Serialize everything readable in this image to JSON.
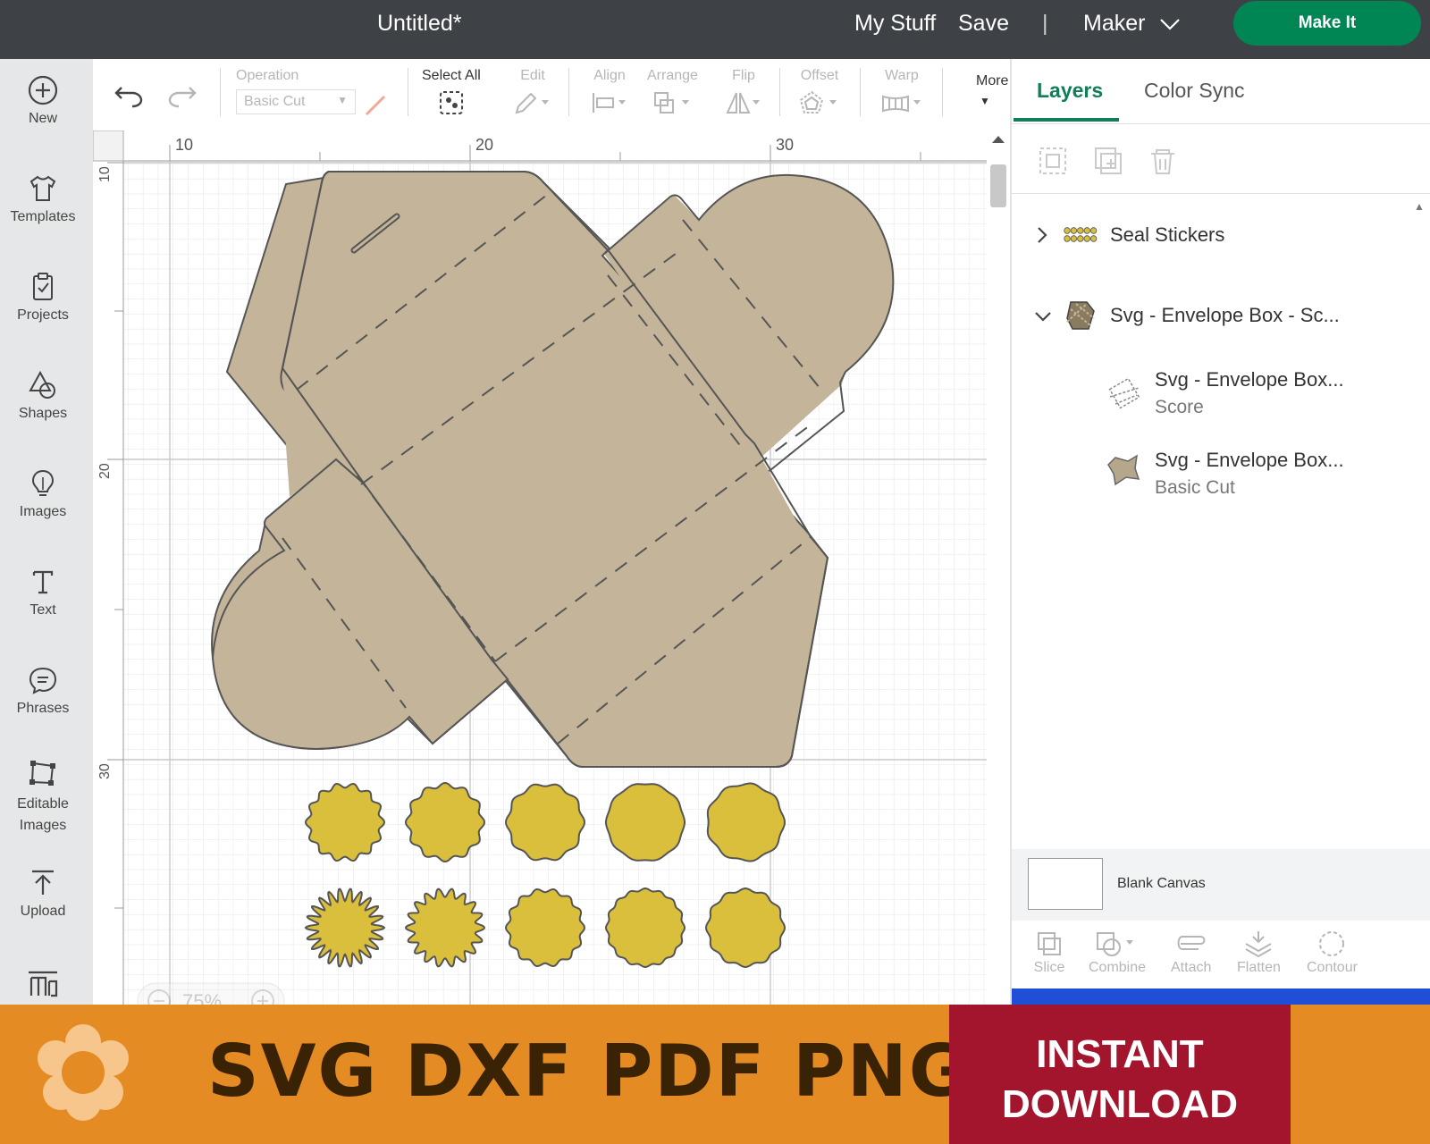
{
  "topbar": {
    "title": "Untitled*",
    "my_stuff": "My Stuff",
    "save": "Save",
    "divider": "|",
    "machine": "Maker",
    "make_it": "Make It"
  },
  "leftnav": {
    "items": [
      {
        "label": "New",
        "icon": "plus-circle-icon"
      },
      {
        "label": "Templates",
        "icon": "shirt-icon"
      },
      {
        "label": "Projects",
        "icon": "clipboard-icon"
      },
      {
        "label": "Shapes",
        "icon": "shapes-icon"
      },
      {
        "label": "Images",
        "icon": "lightbulb-icon"
      },
      {
        "label": "Text",
        "icon": "text-icon"
      },
      {
        "label": "Phrases",
        "icon": "speech-bubble-icon"
      },
      {
        "label": "Editable Images",
        "icon": "editable-image-icon"
      },
      {
        "label": "Upload",
        "icon": "upload-icon"
      }
    ],
    "bottom_icon": "monogram-icon"
  },
  "toolbar": {
    "operation_label": "Operation",
    "operation_value": "Basic Cut",
    "select_all": "Select All",
    "edit": "Edit",
    "align": "Align",
    "arrange": "Arrange",
    "flip": "Flip",
    "offset": "Offset",
    "warp": "Warp",
    "more": "More"
  },
  "canvas": {
    "ruler_top": [
      "10",
      "20",
      "30"
    ],
    "ruler_left": [
      "10",
      "20",
      "30"
    ],
    "zoom": "75%",
    "envelope_color": "#c4b59a",
    "sticker_color": "#d9bf3c"
  },
  "rightpanel": {
    "tabs": [
      "Layers",
      "Color Sync"
    ],
    "active_tab": "Layers",
    "layers": {
      "group1": "Seal Stickers",
      "group2": "Svg - Envelope Box - Sc...",
      "child1_name": "Svg - Envelope Box...",
      "child1_op": "Score",
      "child2_name": "Svg - Envelope Box...",
      "child2_op": "Basic Cut"
    },
    "blank_canvas": "Blank Canvas",
    "bottom_tools": [
      "Slice",
      "Combine",
      "Attach",
      "Flatten",
      "Contour"
    ]
  },
  "banner": {
    "formats": "SVG DXF PDF PNG",
    "instant_line1": "INSTANT",
    "instant_line2": "DOWNLOAD"
  },
  "colors": {
    "topbar": "#3e4247",
    "accent_green": "#008554",
    "banner_orange": "#e48c23",
    "banner_red": "#a3152d"
  }
}
